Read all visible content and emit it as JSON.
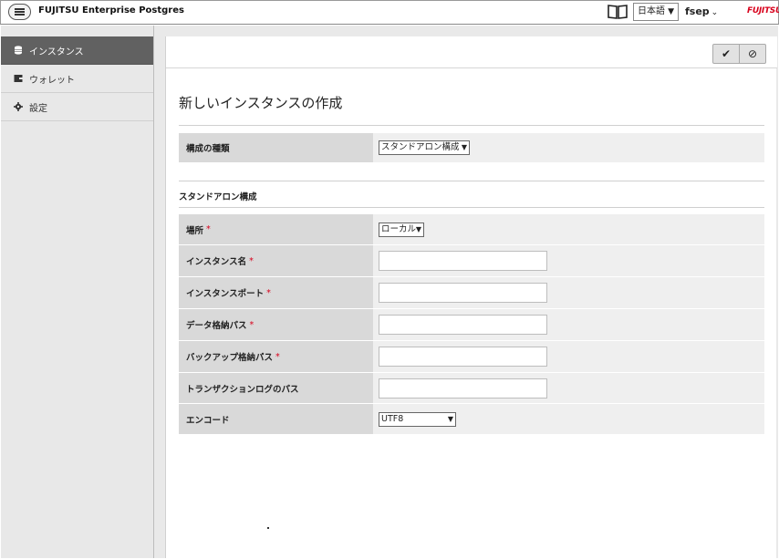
{
  "header": {
    "app_title": "FUJITSU Enterprise Postgres",
    "language": "日本語",
    "user": "fsep",
    "brand": "FUJITSU"
  },
  "sidebar": {
    "items": [
      {
        "label": "インスタンス",
        "icon": "database-icon",
        "active": true
      },
      {
        "label": "ウォレット",
        "icon": "wallet-icon",
        "active": false
      },
      {
        "label": "設定",
        "icon": "gear-icon",
        "active": false
      }
    ]
  },
  "toolbar": {
    "ok_icon": "✔",
    "cancel_icon": "⊘"
  },
  "page": {
    "title": "新しいインスタンスの作成",
    "config_type_label": "構成の種類",
    "config_type_value": "スタンドアロン構成",
    "section_title": "スタンドアロン構成",
    "fields": {
      "location_label": "場所",
      "location_value": "ローカル",
      "instance_name_label": "インスタンス名",
      "instance_name_value": "",
      "instance_port_label": "インスタンスポート",
      "instance_port_value": "",
      "data_path_label": "データ格納パス",
      "data_path_value": "",
      "backup_path_label": "バックアップ格納パス",
      "backup_path_value": "",
      "txlog_path_label": "トランザクションログのパス",
      "txlog_path_value": "",
      "encoding_label": "エンコード",
      "encoding_value": "UTF8"
    },
    "required_mark": "*"
  },
  "colors": {
    "brand_red": "#d8001b",
    "sidebar_active": "#616161",
    "label_bg": "#d9d9d9",
    "value_bg": "#efefef"
  }
}
